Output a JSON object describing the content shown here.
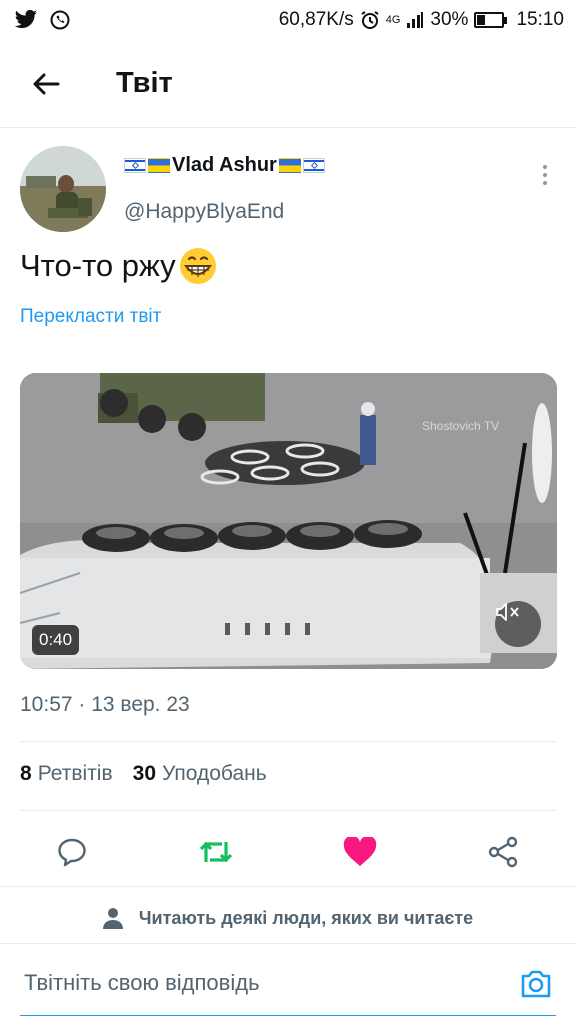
{
  "status_bar": {
    "speed": "60,87K/s",
    "network": "4G",
    "battery": "30%",
    "battery_level": 0.3,
    "time": "15:10"
  },
  "header": {
    "title": "Твіт"
  },
  "tweet": {
    "author_name": "Vlad Ashur",
    "handle": "@HappyBlyaEnd",
    "text": "Что-то ржу",
    "translate_label": "Перекласти твіт",
    "video_duration": "0:40",
    "video_watermark": "Shostovich TV",
    "timestamp": "10:57 · 13 вер. 23"
  },
  "stats": {
    "retweets_count": "8",
    "retweets_label": "Ретвітів",
    "likes_count": "30",
    "likes_label": "Уподобань"
  },
  "colors": {
    "accent": "#1d9bf0",
    "retweet": "#17bf63",
    "like": "#f91880",
    "secondary_text": "#536471"
  },
  "readers_notice": "Читають деякі люди, яких ви читаєте",
  "reply": {
    "placeholder": "Твітніть свою відповідь"
  }
}
